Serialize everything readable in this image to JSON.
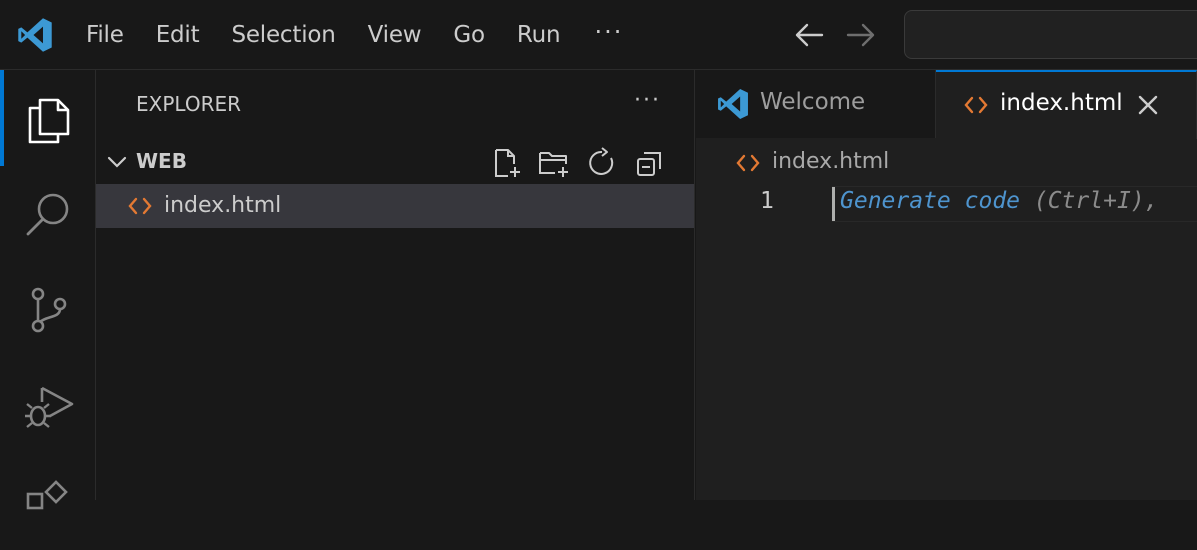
{
  "menu": {
    "items": [
      "File",
      "Edit",
      "Selection",
      "View",
      "Go",
      "Run"
    ],
    "more": "···"
  },
  "sidebar": {
    "title": "EXPLORER",
    "more": "···",
    "section": "WEB",
    "files": [
      {
        "name": "index.html",
        "selected": true
      }
    ]
  },
  "tabs": [
    {
      "label": "Welcome",
      "active": false
    },
    {
      "label": "index.html",
      "active": true
    }
  ],
  "breadcrumb": {
    "file": "index.html"
  },
  "editor": {
    "line_number": "1",
    "hint_main": "Generate code",
    "hint_sub": " (Ctrl+I),"
  },
  "colors": {
    "accent": "#0078d4",
    "html_icon": "#e37933",
    "vscode_blue": "#3c99d4"
  },
  "icons": {
    "app": "vscode-logo-icon",
    "back": "arrow-left-icon",
    "forward": "arrow-right-icon",
    "explorer": "files-icon",
    "search": "search-icon",
    "scm": "source-control-icon",
    "debug": "run-debug-icon",
    "extensions": "extensions-icon"
  }
}
